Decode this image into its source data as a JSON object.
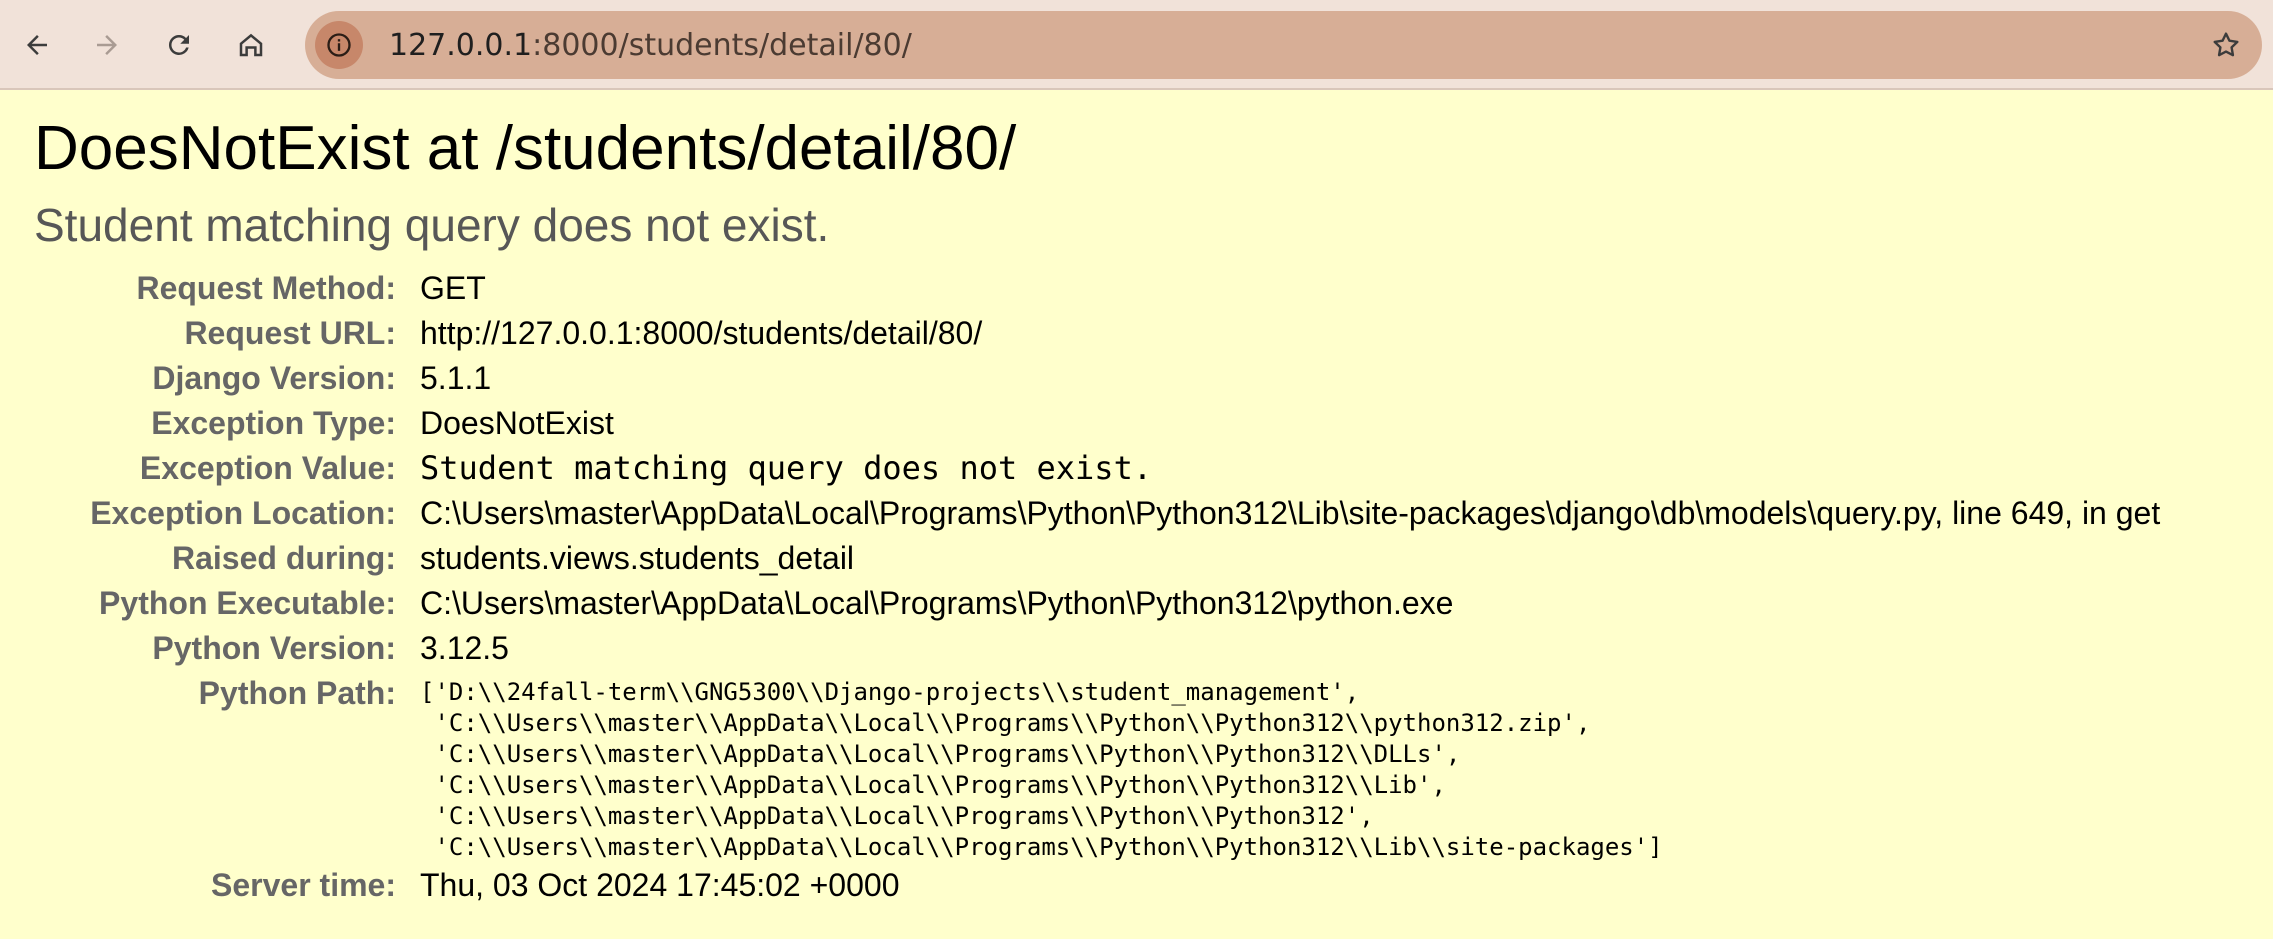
{
  "browser": {
    "url_host": "127.0.0.1",
    "url_rest": ":8000/students/detail/80/",
    "icons": [
      "back-icon",
      "forward-icon",
      "reload-icon",
      "home-icon",
      "site-info-icon",
      "bookmark-star-icon"
    ]
  },
  "page": {
    "title": "DoesNotExist at /students/detail/80/",
    "subtitle": "Student matching query does not exist."
  },
  "meta": {
    "request_method": {
      "label": "Request Method:",
      "value": "GET"
    },
    "request_url": {
      "label": "Request URL:",
      "value": "http://127.0.0.1:8000/students/detail/80/"
    },
    "django_version": {
      "label": "Django Version:",
      "value": "5.1.1"
    },
    "exception_type": {
      "label": "Exception Type:",
      "value": "DoesNotExist"
    },
    "exception_value": {
      "label": "Exception Value:",
      "value": "Student matching query does not exist."
    },
    "exception_location": {
      "label": "Exception Location:",
      "value": "C:\\Users\\master\\AppData\\Local\\Programs\\Python\\Python312\\Lib\\site-packages\\django\\db\\models\\query.py, line 649, in get"
    },
    "raised_during": {
      "label": "Raised during:",
      "value": "students.views.students_detail"
    },
    "python_executable": {
      "label": "Python Executable:",
      "value": "C:\\Users\\master\\AppData\\Local\\Programs\\Python\\Python312\\python.exe"
    },
    "python_version": {
      "label": "Python Version:",
      "value": "3.12.5"
    },
    "python_path": {
      "label": "Python Path:",
      "lines": [
        "['D:\\\\24fall-term\\\\GNG5300\\\\Django-projects\\\\student_management',",
        " 'C:\\\\Users\\\\master\\\\AppData\\\\Local\\\\Programs\\\\Python\\\\Python312\\\\python312.zip',",
        " 'C:\\\\Users\\\\master\\\\AppData\\\\Local\\\\Programs\\\\Python\\\\Python312\\\\DLLs',",
        " 'C:\\\\Users\\\\master\\\\AppData\\\\Local\\\\Programs\\\\Python\\\\Python312\\\\Lib',",
        " 'C:\\\\Users\\\\master\\\\AppData\\\\Local\\\\Programs\\\\Python\\\\Python312',",
        " 'C:\\\\Users\\\\master\\\\AppData\\\\Local\\\\Programs\\\\Python\\\\Python312\\\\Lib\\\\site-packages']"
      ]
    },
    "server_time": {
      "label": "Server time:",
      "value": "Thu, 03 Oct 2024 17:45:02 +0000"
    }
  }
}
